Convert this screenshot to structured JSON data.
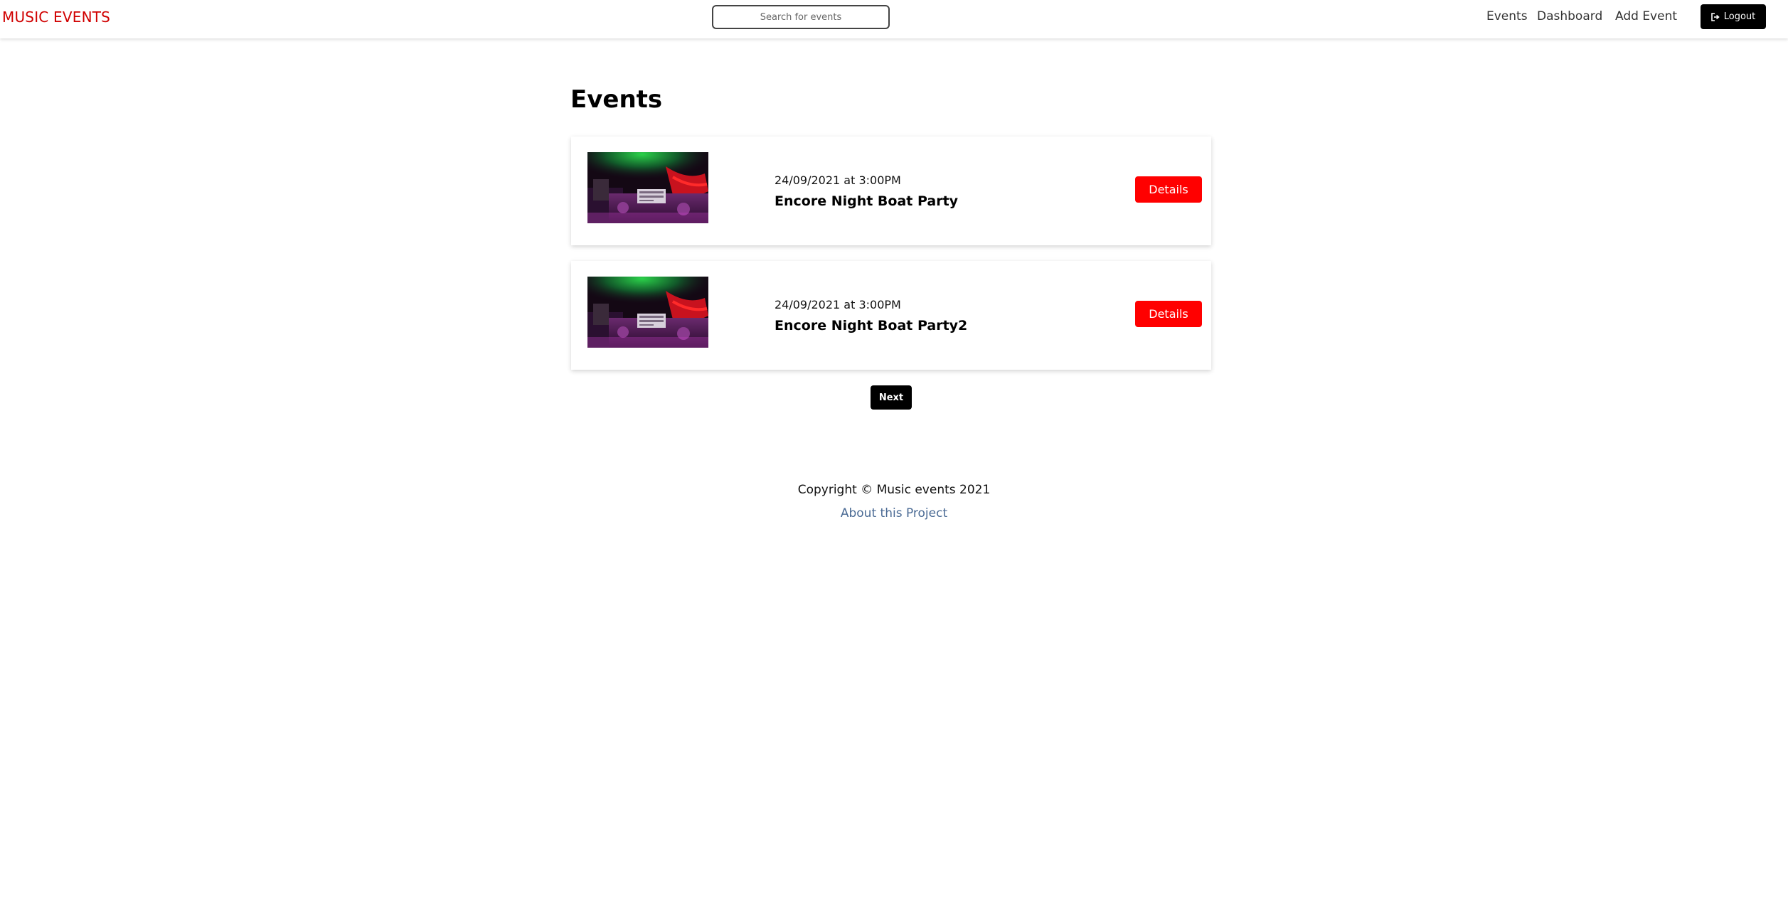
{
  "header": {
    "logo": "MUSIC EVENTS",
    "search_placeholder": "Search for events",
    "nav": {
      "events": "Events",
      "dashboard": "Dashboard",
      "add_event": "Add Event",
      "logout": "Logout"
    }
  },
  "main": {
    "title": "Events",
    "events": [
      {
        "date": "24/09/2021 at 3:00PM",
        "name": "Encore Night Boat Party",
        "details_label": "Details"
      },
      {
        "date": "24/09/2021 at 3:00PM",
        "name": "Encore Night Boat Party2",
        "details_label": "Details"
      }
    ],
    "pagination": {
      "next_label": "Next"
    }
  },
  "footer": {
    "copyright": "Copyright © Music events 2021",
    "about_link": "About this Project"
  },
  "colors": {
    "brand_red": "#d00000",
    "button_red": "#ff0000",
    "dark": "#000000",
    "link_blue": "#4a6a94"
  },
  "icons": {
    "logout": "logout-icon"
  }
}
